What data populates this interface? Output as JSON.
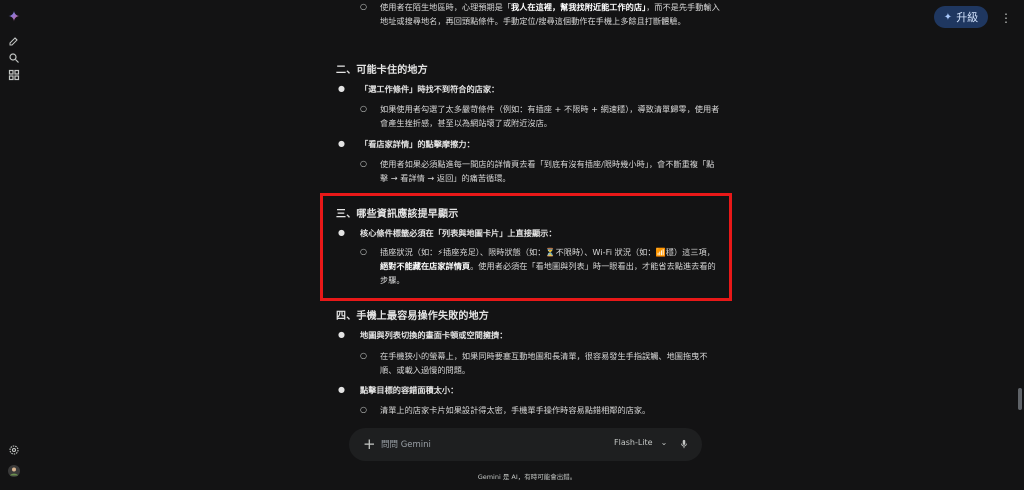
{
  "topbar": {
    "upgrade_label": "升級",
    "more_icon": "vertical-dots-icon"
  },
  "rail": {
    "icons": [
      "gemini-sparkle-icon",
      "new-chat-icon",
      "search-icon",
      "apps-grid-icon",
      "settings-icon",
      "avatar"
    ]
  },
  "content": {
    "top_para": {
      "text_pre": "使用者在陌生地區時，心理預期是「",
      "text_bold": "我人在這裡，幫我找附近能工作的店」",
      "text_post": "，而不是先手動輸入地址或搜尋地名，再回頭點條件。手動定位/搜尋這個動作在手機上多餘且打斷體驗。"
    },
    "section2": {
      "heading": "二、可能卡住的地方",
      "items": [
        {
          "label": "「選工作條件」時找不到符合的店家：",
          "sub": "如果使用者勾選了太多嚴苛條件（例如：有插座 + 不限時 + 網速穩），導致清單歸零，使用者會產生挫折感，甚至以為網站壞了或附近沒店。"
        },
        {
          "label": "「看店家詳情」的點擊摩擦力：",
          "sub": "使用者如果必須點進每一間店的詳情頁去看「到底有沒有插座/限時幾小時」，會不斷重複「點擊 → 看詳情 → 返回」的痛苦循環。"
        }
      ]
    },
    "section3": {
      "heading": "三、哪些資訊應該提早顯示",
      "label": "核心條件標籤必須在「列表與地圖卡片」上直接顯示：",
      "sub_pre": "插座狀況（如：⚡插座充足）、限時狀態（如：⏳不限時）、Wi-Fi 狀況（如：📶穩）這三項，",
      "sub_bold": "絕對不能藏在店家詳情頁",
      "sub_post": "。使用者必須在「看地圖與列表」時一眼看出，才能省去點進去看的步驟。"
    },
    "section4": {
      "heading": "四、手機上最容易操作失敗的地方",
      "items": [
        {
          "label": "地圖與列表切換的畫面卡頓或空間擁擠：",
          "sub": "在手機狹小的螢幕上，如果同時要塞互動地圖和長清單，很容易發生手指誤觸、地圖拖曳不順、或載入過慢的問題。"
        },
        {
          "label": "點擊目標的容錯面積太小：",
          "sub": "清單上的店家卡片如果設計得太密，手機單手操作時容易點錯相鄰的店家。"
        }
      ]
    }
  },
  "input": {
    "placeholder": "問問 Gemini",
    "model": "Flash-Lite"
  },
  "footer": "Gemini 是 AI，有時可能會出錯。"
}
